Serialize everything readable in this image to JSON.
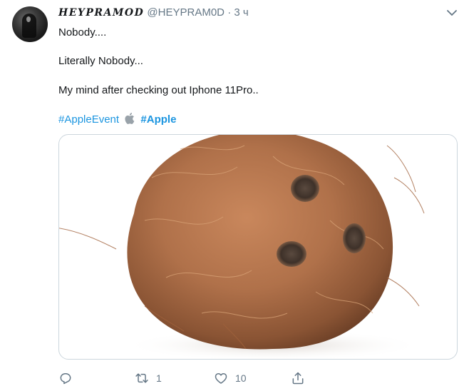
{
  "tweet": {
    "display_name": "HEYPRAMOD",
    "handle": "@HEYPRAM0D",
    "separator": "·",
    "time": "3 ч",
    "lines": [
      "Nobody....",
      "Literally Nobody...",
      "My mind after checking out Iphone 11Pro.."
    ],
    "hashtags": [
      "#AppleEvent",
      "#Apple"
    ],
    "media_alt": "coconut"
  },
  "actions": {
    "reply_count": "",
    "retweet_count": "1",
    "like_count": "10"
  },
  "colors": {
    "link": "#1b95e0",
    "muted": "#657786",
    "text": "#14171a",
    "border": "#ccd6dd"
  },
  "icons": [
    "more-options-chevron-icon",
    "apple-logo-icon",
    "reply-icon",
    "retweet-icon",
    "like-heart-icon",
    "share-icon"
  ]
}
